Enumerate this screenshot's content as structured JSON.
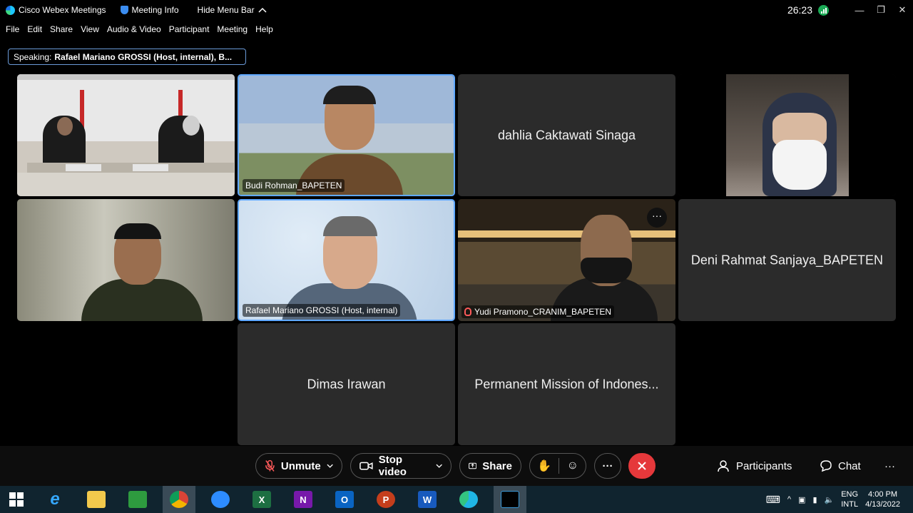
{
  "titlebar": {
    "app_name": "Cisco Webex Meetings",
    "meeting_info": "Meeting Info",
    "hide_menu": "Hide Menu Bar",
    "timer": "26:23"
  },
  "menu": [
    "File",
    "Edit",
    "Share",
    "View",
    "Audio & Video",
    "Participant",
    "Meeting",
    "Help"
  ],
  "speaking": {
    "prefix": "Speaking:",
    "names": "Rafael Mariano GROSSI (Host, internal), B..."
  },
  "tiles": {
    "t2_name": "Budi Rohman_BAPETEN",
    "t3_name": "dahlia Caktawati Sinaga",
    "t6_name": "Rafael Mariano GROSSI (Host, internal)",
    "t7_name": "Yudi Pramono_CRANIM_BAPETEN",
    "t8_name": "Deni Rahmat Sanjaya_BAPETEN",
    "t9_name": "Dimas Irawan",
    "t10_name": "Permanent Mission of Indones..."
  },
  "controls": {
    "unmute": "Unmute",
    "stop_video": "Stop video",
    "share": "Share",
    "more": "···",
    "participants": "Participants",
    "chat": "Chat"
  },
  "taskbar": {
    "lang1": "ENG",
    "lang2": "INTL",
    "time": "4:00 PM",
    "date": "4/13/2022"
  },
  "colors": {
    "accent_border": "#5fa8ff",
    "end_button": "#e5383b",
    "mute_red": "#ff5a5a"
  }
}
